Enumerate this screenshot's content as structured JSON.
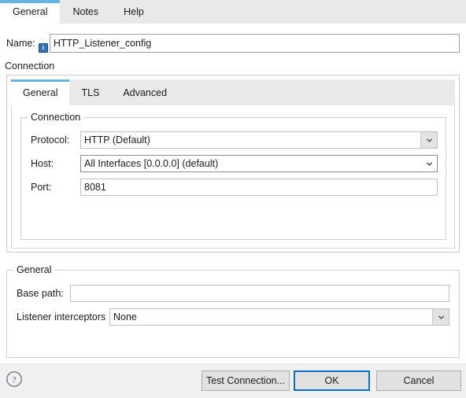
{
  "colors": {
    "accent_blue": "#63b4e0",
    "focus_blue": "#0072c6",
    "info_badge": "#2f72b5",
    "tabbar_bg": "#e9e9e9",
    "buttonbar_bg": "#f0f0f0"
  },
  "top_tabs": [
    {
      "label": "General",
      "active": true
    },
    {
      "label": "Notes",
      "active": false
    },
    {
      "label": "Help",
      "active": false
    }
  ],
  "name_field": {
    "label": "Name:",
    "value": "HTTP_Listener_config",
    "badge_icon": "info-icon",
    "badge_glyph": "i"
  },
  "connection_section": {
    "title": "Connection",
    "tabs": [
      {
        "label": "General",
        "active": true
      },
      {
        "label": "TLS",
        "active": false
      },
      {
        "label": "Advanced",
        "active": false
      }
    ],
    "group": {
      "legend": "Connection",
      "rows": [
        {
          "label": "Protocol:",
          "type": "combo-flat",
          "value": "HTTP (Default)",
          "icon": "chevron-down-icon"
        },
        {
          "label": "Host:",
          "type": "combo-framed",
          "value": "All Interfaces [0.0.0.0] (default)",
          "icon": "chevron-down-icon"
        },
        {
          "label": "Port:",
          "type": "text",
          "value": "8081"
        }
      ]
    }
  },
  "general_section": {
    "legend": "General",
    "base_path": {
      "label": "Base path:",
      "value": "",
      "placeholder": ""
    },
    "listener_interceptors": {
      "label": "Listener interceptors",
      "value": "None",
      "icon": "chevron-down-icon"
    }
  },
  "buttonbar": {
    "help_icon": "help-circle-icon",
    "help_glyph": "?",
    "test_connection": "Test Connection...",
    "ok": "OK",
    "cancel": "Cancel"
  }
}
